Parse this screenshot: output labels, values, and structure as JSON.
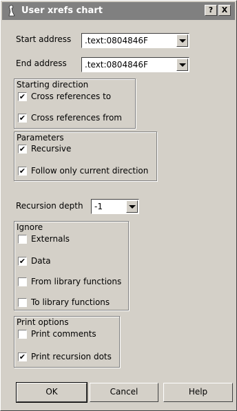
{
  "window": {
    "title": "User xrefs chart",
    "help_button": "?",
    "close_button": "X"
  },
  "fields": {
    "start_label": "Start address",
    "start_value": ".text:0804846F",
    "end_label": "End address",
    "end_value": ".text:0804846F",
    "depth_label": "Recursion depth",
    "depth_value": "-1"
  },
  "groups": {
    "direction": {
      "title": "Starting direction",
      "items": [
        {
          "label": "Cross references to",
          "checked": true
        },
        {
          "label": "Cross references from",
          "checked": true
        }
      ]
    },
    "parameters": {
      "title": "Parameters",
      "items": [
        {
          "label": "Recursive",
          "checked": true
        },
        {
          "label": "Follow only current direction",
          "checked": true
        }
      ]
    },
    "ignore": {
      "title": "Ignore",
      "items": [
        {
          "label": "Externals",
          "checked": false
        },
        {
          "label": "Data",
          "checked": true
        },
        {
          "label": "From library functions",
          "checked": false
        },
        {
          "label": "To library functions",
          "checked": false
        }
      ]
    },
    "print": {
      "title": "Print options",
      "items": [
        {
          "label": "Print comments",
          "checked": false
        },
        {
          "label": "Print recursion dots",
          "checked": true
        }
      ]
    }
  },
  "buttons": {
    "ok": "OK",
    "cancel": "Cancel",
    "help": "Help"
  },
  "icons": {
    "title": "bird-icon",
    "checkmark": "✔"
  }
}
